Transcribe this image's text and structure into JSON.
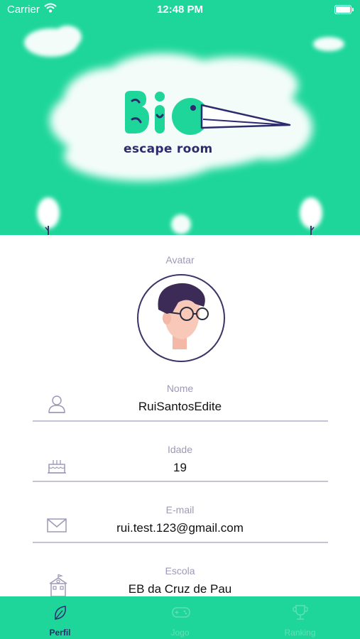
{
  "status_bar": {
    "carrier": "Carrier",
    "time": "12:48 PM"
  },
  "hero": {
    "brand_title": "Bio",
    "brand_subtitle": "escape room"
  },
  "form": {
    "avatar_label": "Avatar",
    "fields": [
      {
        "label": "Nome",
        "value": "RuiSantosEdite",
        "icon": "user-icon"
      },
      {
        "label": "Idade",
        "value": "19",
        "icon": "birthday-cake-icon"
      },
      {
        "label": "E-mail",
        "value": "rui.test.123@gmail.com",
        "icon": "envelope-icon"
      },
      {
        "label": "Escola",
        "value": "EB da Cruz de Pau",
        "icon": "school-icon"
      }
    ]
  },
  "tab_bar": {
    "tabs": [
      {
        "label": "Perfil",
        "icon": "leaf-icon",
        "active": true
      },
      {
        "label": "Jogo",
        "icon": "controller-icon",
        "active": false
      },
      {
        "label": "Ranking",
        "icon": "trophy-icon",
        "active": false
      }
    ]
  },
  "colors": {
    "brand_green": "#1ed69a",
    "navy": "#2b2b6e",
    "label_grey": "#9c9ab8"
  }
}
